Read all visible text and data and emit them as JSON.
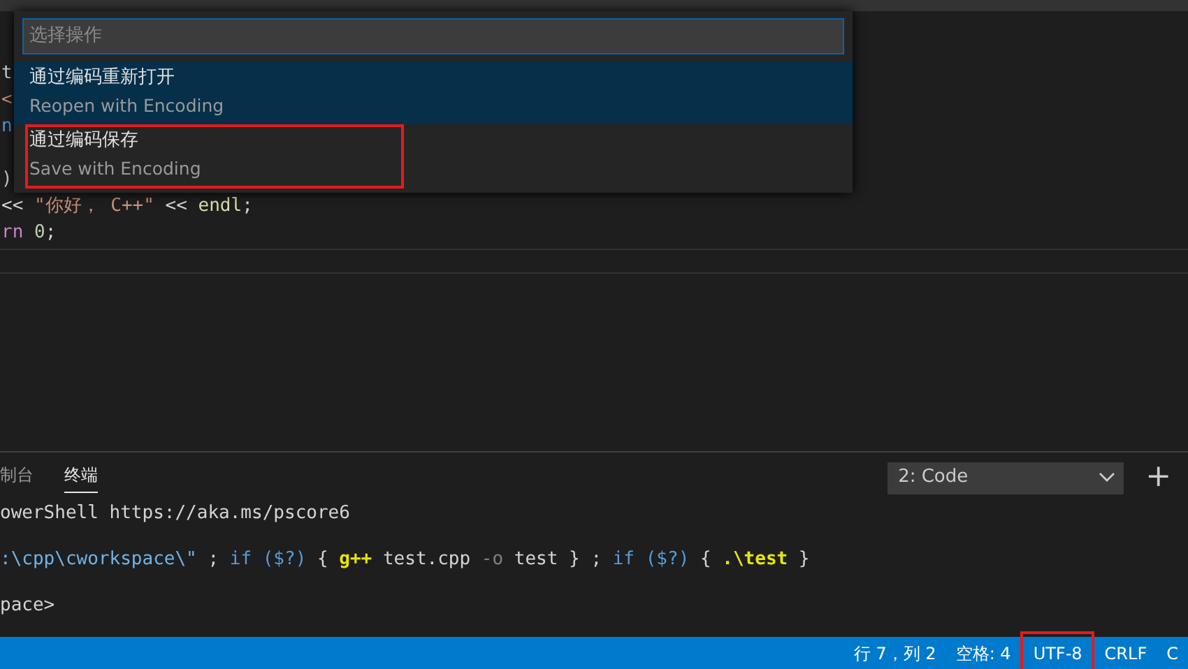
{
  "editor": {
    "lines": [
      {
        "kind": "code",
        "tokens": [
          {
            "kind": "plain",
            "text": "t"
          }
        ]
      },
      {
        "kind": "code",
        "tokens": [
          {
            "kind": "string",
            "text": "<"
          }
        ]
      },
      {
        "kind": "code",
        "tokens": [
          {
            "kind": "keyword",
            "text": "n"
          }
        ]
      },
      {
        "kind": "blank"
      },
      {
        "kind": "code",
        "tokens": [
          {
            "kind": "plain",
            "text": ")"
          }
        ]
      },
      {
        "kind": "code",
        "tokens": [
          {
            "kind": "plain",
            "text": "<< "
          },
          {
            "kind": "string",
            "text": "\"你好， C++\""
          },
          {
            "kind": "plain",
            "text": " << "
          },
          {
            "kind": "function",
            "text": "endl"
          },
          {
            "kind": "plain",
            "text": ";"
          }
        ]
      },
      {
        "kind": "code",
        "tokens": [
          {
            "kind": "control",
            "text": "rn "
          },
          {
            "kind": "number",
            "text": "0"
          },
          {
            "kind": "plain",
            "text": ";"
          }
        ]
      }
    ]
  },
  "quick_pick": {
    "placeholder": "选择操作",
    "items": [
      {
        "label": "通过编码重新打开",
        "description": "Reopen with Encoding",
        "selected": true,
        "highlighted": false
      },
      {
        "label": "通过编码保存",
        "description": "Save with Encoding",
        "selected": false,
        "highlighted": true
      }
    ]
  },
  "panel": {
    "tabs": [
      {
        "label": "制台",
        "selected": false
      },
      {
        "label": "终端",
        "selected": true
      }
    ],
    "terminal_select": {
      "value": "2: Code"
    },
    "add_button": "+",
    "terminal_lines": [
      {
        "kind": "code",
        "tokens": [
          {
            "kind": "plain",
            "text": "owerShell https://aka.ms/pscore6"
          }
        ]
      },
      {
        "kind": "blank"
      },
      {
        "kind": "code",
        "tokens": [
          {
            "kind": "path",
            "text": ":\\cpp\\cworkspace\\\""
          },
          {
            "kind": "plain",
            "text": " ; "
          },
          {
            "kind": "keyword",
            "text": "if "
          },
          {
            "kind": "keyword",
            "text": "($?)"
          },
          {
            "kind": "plain",
            "text": " { "
          },
          {
            "kind": "command",
            "text": "g++"
          },
          {
            "kind": "plain",
            "text": " test.cpp "
          },
          {
            "kind": "dim",
            "text": "-o"
          },
          {
            "kind": "plain",
            "text": " test } ; "
          },
          {
            "kind": "keyword",
            "text": "if "
          },
          {
            "kind": "keyword",
            "text": "($?)"
          },
          {
            "kind": "plain",
            "text": " { "
          },
          {
            "kind": "command",
            "text": ".\\test"
          },
          {
            "kind": "plain",
            "text": " }"
          }
        ]
      },
      {
        "kind": "blank"
      },
      {
        "kind": "code",
        "tokens": [
          {
            "kind": "plain",
            "text": "pace>"
          }
        ]
      }
    ]
  },
  "status_bar": {
    "items": [
      {
        "text": "行 7，列 2",
        "highlighted": false
      },
      {
        "text": "空格: 4",
        "highlighted": false
      },
      {
        "text": "UTF-8",
        "highlighted": true
      },
      {
        "text": "CRLF",
        "highlighted": false
      },
      {
        "text": "C",
        "highlighted": false
      }
    ]
  }
}
